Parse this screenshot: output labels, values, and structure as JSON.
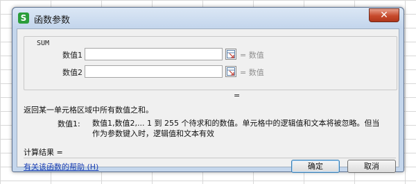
{
  "dialog": {
    "app_icon": "S",
    "title": "函数参数",
    "close_label": "✕"
  },
  "group": {
    "function_name": "SUM",
    "args": [
      {
        "label": "数值1",
        "value": "",
        "result": "= 数值"
      },
      {
        "label": "数值2",
        "value": "",
        "result": "= 数值"
      }
    ]
  },
  "formula_result": "=",
  "description": "返回某一单元格区域中所有数值之和。",
  "param_help": {
    "name": "数值1:",
    "text": "数值1,数值2,... 1 到 255 个待求和的数值。单元格中的逻辑值和文本将被忽略。但当作为参数键入时，逻辑值和文本有效"
  },
  "calc_result_label": "计算结果 =",
  "help_link": "有关该函数的帮助 (H)",
  "buttons": {
    "ok": "确定",
    "cancel": "取消"
  },
  "icons": {
    "picker": "range-picker-icon",
    "close": "close-icon"
  }
}
